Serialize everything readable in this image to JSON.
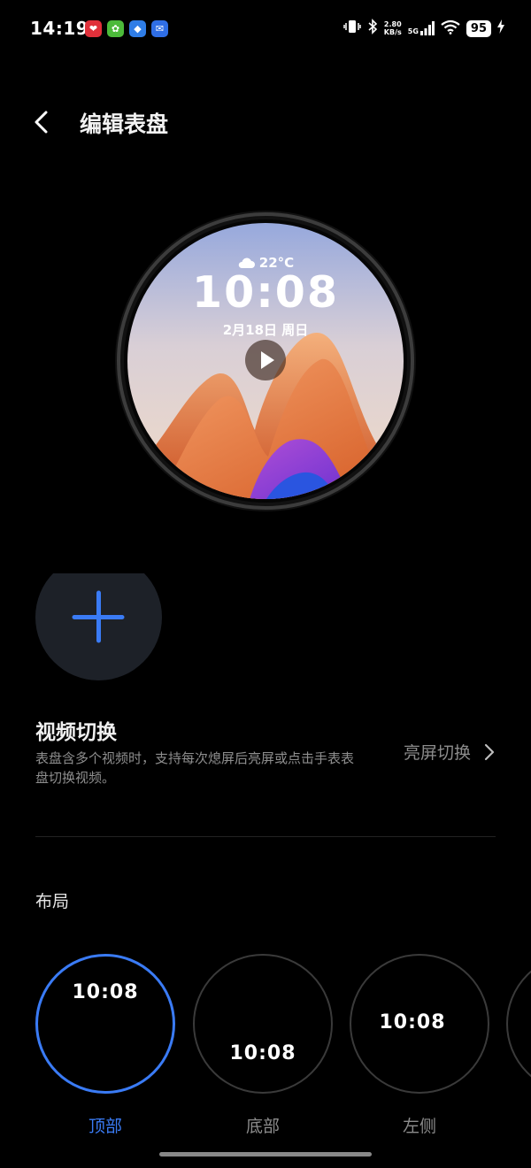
{
  "status_bar": {
    "time": "14:19",
    "apps": [
      {
        "icon": "heart-app-icon",
        "color": "#e0303a",
        "glyph": "❤"
      },
      {
        "icon": "android-app-icon",
        "color": "#4cba3a",
        "glyph": "✿"
      },
      {
        "icon": "store-app-icon",
        "color": "#2f7de6",
        "glyph": "◆"
      },
      {
        "icon": "mail-app-icon",
        "color": "#2f6ee6",
        "glyph": "✉"
      }
    ],
    "net_speed_value": "2.80",
    "net_speed_unit": "KB/s",
    "network_type": "5G",
    "battery": "95"
  },
  "header": {
    "title": "编辑表盘"
  },
  "watch_face": {
    "temperature": "22°C",
    "time": "10:08",
    "date": "2月18日 周日"
  },
  "video_switch": {
    "title": "视频切换",
    "description": "表盘含多个视频时，支持每次熄屏后亮屏或点击手表表盘切换视频。",
    "value": "亮屏切换"
  },
  "layout": {
    "title": "布局",
    "options": [
      {
        "label": "顶部",
        "time": "10:08",
        "selected": true
      },
      {
        "label": "底部",
        "time": "10:08",
        "selected": false
      },
      {
        "label": "左侧",
        "time": "10:08",
        "selected": false
      }
    ]
  },
  "colors": {
    "accent": "#3a7bf5",
    "background": "#000000",
    "secondary_text": "#8c8c8c"
  }
}
